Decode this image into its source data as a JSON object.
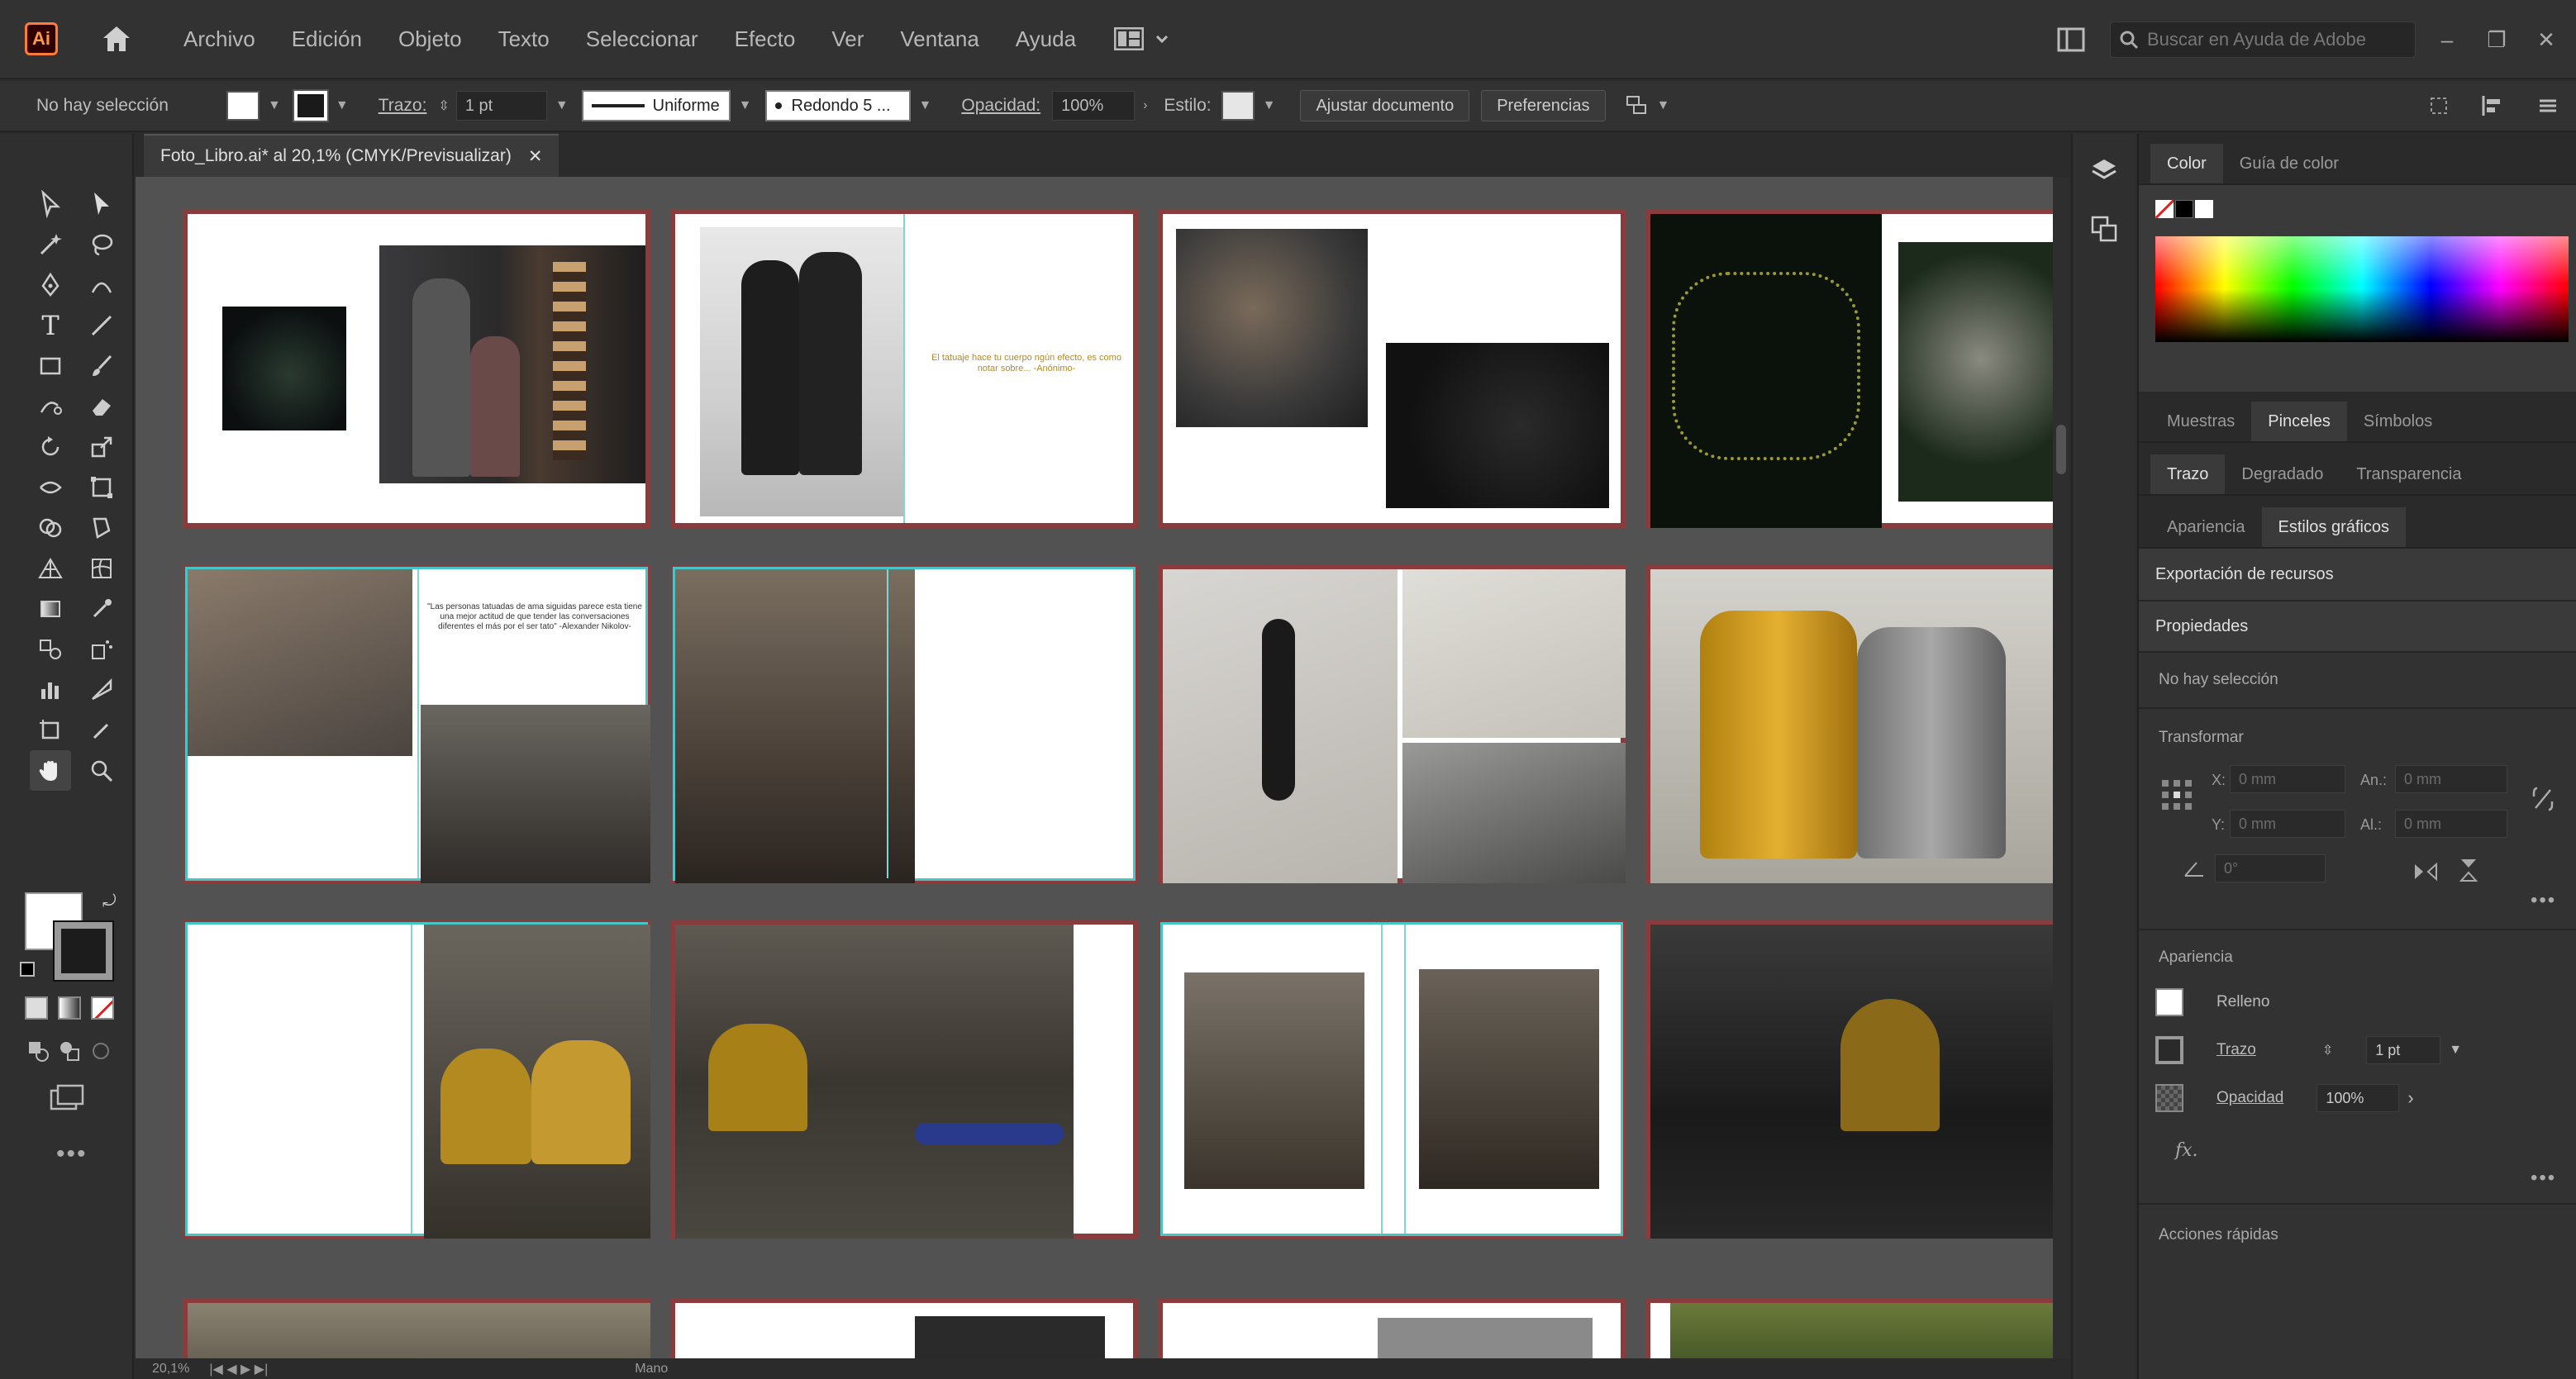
{
  "app": {
    "logo_text": "Ai"
  },
  "menu": [
    "Archivo",
    "Edición",
    "Objeto",
    "Texto",
    "Seleccionar",
    "Efecto",
    "Ver",
    "Ventana",
    "Ayuda"
  ],
  "search": {
    "placeholder": "Buscar en Ayuda de Adobe"
  },
  "window_controls": {
    "minimize": "–",
    "restore": "❐",
    "close": "✕"
  },
  "controlbar": {
    "selection": "No hay selección",
    "stroke_label": "Trazo:",
    "stroke_weight": "1 pt",
    "stroke_profile": "Uniforme",
    "brush": "Redondo 5 ...",
    "opacity_label": "Opacidad:",
    "opacity_value": "100%",
    "style_label": "Estilo:",
    "doc_button": "Ajustar documento",
    "prefs_button": "Preferencias"
  },
  "document": {
    "tab_title": "Foto_Libro.ai* al 20,1% (CMYK/Previsualizar)",
    "close": "✕",
    "quote1": "El tatuaje hace tu cuerpo ngún efecto, es como notar sobre... -Anónimo-",
    "quote2": "\"Las personas tatuadas de ama siguidas parece esta tiene una mejor actitud de que tender las conversaciones diferentes el más por el ser tato\" -Alexander Nikolov-"
  },
  "statusbar": {
    "zoom": "20,1%",
    "tool": "Mano"
  },
  "panels": {
    "tabs_row1": [
      "Color",
      "Guía de color"
    ],
    "tabs_row2": [
      "Muestras",
      "Pinceles",
      "Símbolos"
    ],
    "tabs_row3": [
      "Trazo",
      "Degradado",
      "Transparencia"
    ],
    "tabs_row4": [
      "Apariencia",
      "Estilos gráficos"
    ],
    "export_label": "Exportación de recursos",
    "properties_label": "Propiedades",
    "no_selection": "No hay selección",
    "transform_label": "Transformar",
    "x_label": "X:",
    "y_label": "Y:",
    "w_label": "An.:",
    "h_label": "Al.:",
    "x_value": "0 mm",
    "y_value": "0 mm",
    "w_value": "0 mm",
    "h_value": "0 mm",
    "angle_value": "0°",
    "appearance_label": "Apariencia",
    "fill_label": "Relleno",
    "stroke_label": "Trazo",
    "stroke_value": "1 pt",
    "opacity_label": "Opacidad",
    "opacity_value": "100%",
    "fx_label": "fx.",
    "quick_actions_label": "Acciones rápidas"
  },
  "colors": {
    "accent_selected": "#46c6c6",
    "artboard_border": "#8a3b3b",
    "quote_gold": "#b08a2a"
  }
}
